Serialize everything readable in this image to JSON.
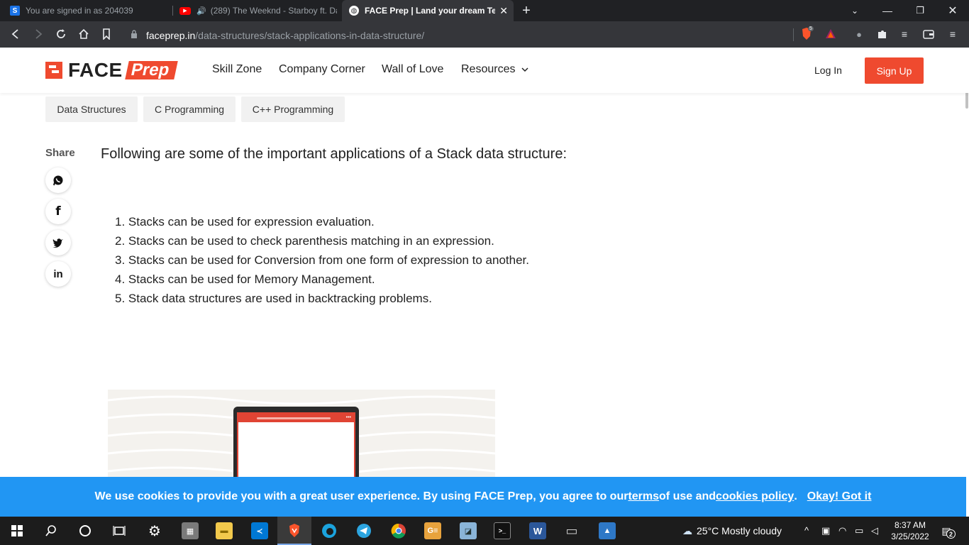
{
  "browser": {
    "tabs": [
      {
        "title": "You are signed in as 204039",
        "favicon": "S"
      },
      {
        "title": "(289) The Weeknd - Starboy ft. Daft Punk",
        "favicon": "youtube-icon",
        "audio": "speaker-icon"
      },
      {
        "title": "FACE Prep | Land your dream Tech Job",
        "favicon": "globe-icon",
        "active": true
      }
    ],
    "new_tab": "+",
    "url_host": "faceprep.in",
    "url_path": "/data-structures/stack-applications-in-data-structure/",
    "brave_shield_count": "5"
  },
  "site": {
    "logo_face": "FACE",
    "logo_prep": "Prep",
    "nav": [
      "Skill Zone",
      "Company Corner",
      "Wall of Love",
      "Resources"
    ],
    "login": "Log In",
    "signup": "Sign Up",
    "accent_color": "#ef4a2f"
  },
  "tags": [
    "Data Structures",
    "C Programming",
    "C++ Programming"
  ],
  "share": {
    "label": "Share",
    "networks": [
      "whatsapp-icon",
      "facebook-icon",
      "twitter-icon",
      "linkedin-icon"
    ]
  },
  "article": {
    "intro": "Following are some of the important applications of a Stack data structure:",
    "applications": [
      "1. Stacks can be used for expression evaluation.",
      "2. Stacks can be used to check parenthesis matching in an expression.",
      "3. Stacks can be used for Conversion from one form of expression to another.",
      "4. Stacks can be used for Memory Management.",
      "5. Stack data structures are used in backtracking problems."
    ]
  },
  "cookie": {
    "text_before": "We use cookies to provide you with a great user experience. By using FACE Prep, you agree to our ",
    "terms": "terms",
    "middle": " of use and ",
    "policy": "cookies policy",
    "after": ".",
    "ok": "Okay! Got it",
    "color": "#2196f3"
  },
  "taskbar": {
    "weather": "25°C  Mostly cloudy",
    "time": "8:37 AM",
    "date": "3/25/2022",
    "notifications": "2"
  }
}
